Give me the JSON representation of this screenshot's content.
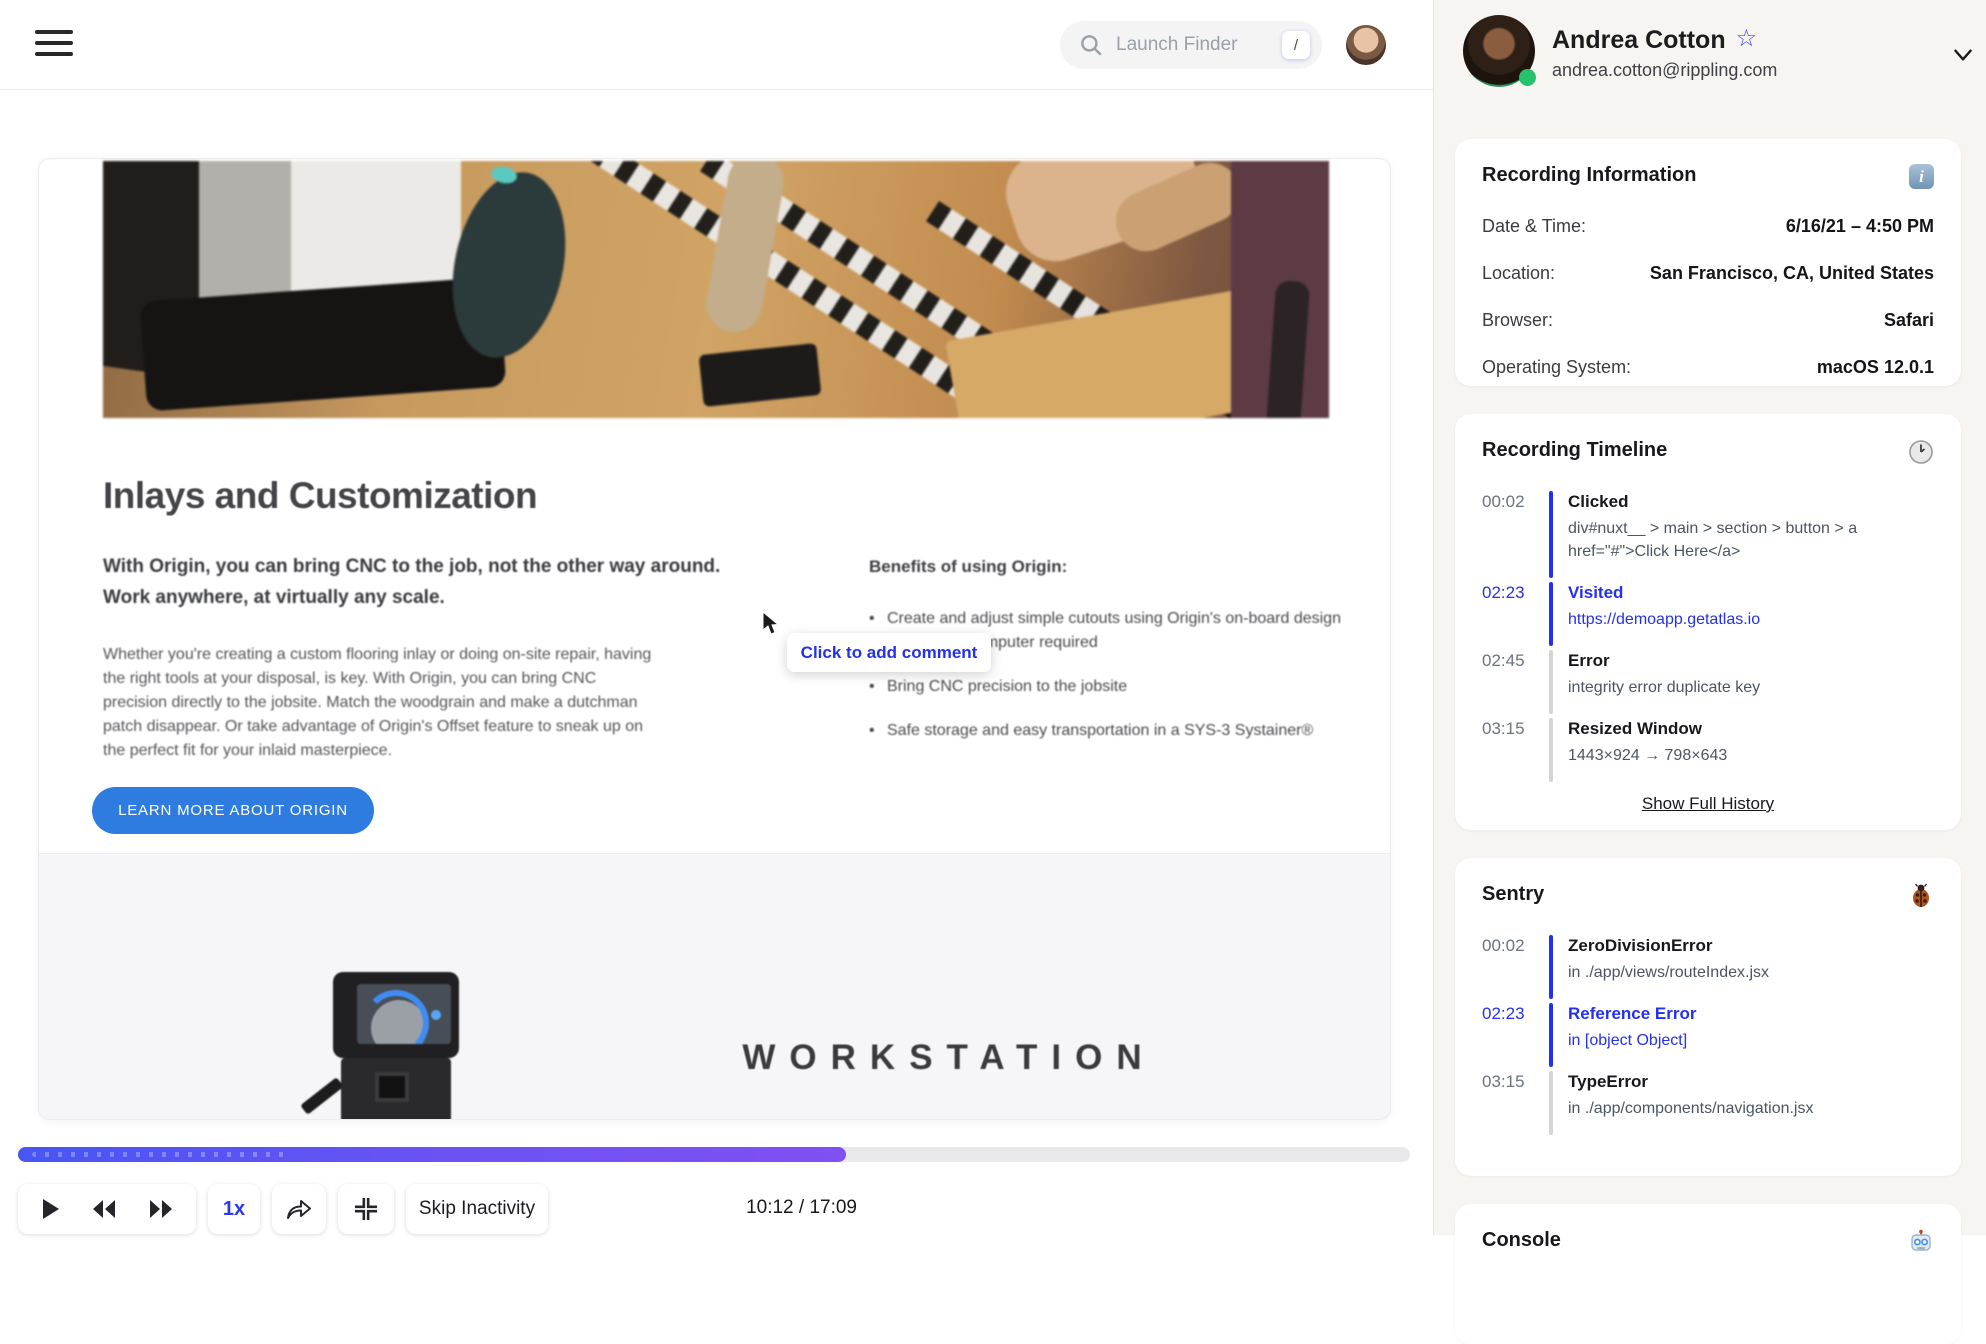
{
  "topbar": {
    "search_placeholder": "Launch Finder",
    "search_shortcut": "/"
  },
  "replay": {
    "url": "https://app.getatlas.io/auth/login?next=/customer-profile/3a092231-4d57-407d-8656-896dee8e4c24",
    "comment_tooltip": "Click to add comment",
    "page": {
      "heading": "Inlays and Customization",
      "intro_bold": "With Origin, you can bring CNC to the job, not the other way around. Work anywhere, at virtually any scale.",
      "paragraph": "Whether you're creating a custom flooring inlay or doing on-site repair, having the right tools at your disposal, is key. With Origin, you can bring CNC precision directly to the jobsite. Match the woodgrain and make a dutchman patch disappear. Or take advantage of Origin's Offset feature to sneak up on the perfect fit for your inlaid masterpiece.",
      "cta_label": "LEARN MORE ABOUT ORIGIN",
      "benefits_title": "Benefits of using Origin:",
      "benefits": [
        {
          "text": "Create and adjust simple cutouts using Origin's on-board design tools — no computer required"
        },
        {
          "text": "Bring CNC precision to the jobsite"
        },
        {
          "text": "Safe storage and easy transportation in a SYS-3 Systainer®"
        }
      ],
      "workstation_label": "WORKSTATION"
    }
  },
  "player": {
    "speed_label": "1x",
    "skip_inactivity_label": "Skip Inactivity",
    "time_display": "10:12 / 17:09",
    "progress_percent": 59.5,
    "progress_gradient": [
      "#4756f3",
      "#8050f2"
    ]
  },
  "sidebar": {
    "user": {
      "name": "Andrea Cotton",
      "email": "andrea.cotton@rippling.com",
      "star_icon": "☆"
    },
    "recording_information": {
      "title": "Recording Information",
      "icon": "info-icon",
      "rows": [
        {
          "label": "Date & Time:",
          "value": "6/16/21 – 4:50 PM"
        },
        {
          "label": "Location:",
          "value": "San Francisco, CA, United States"
        },
        {
          "label": "Browser:",
          "value": "Safari"
        },
        {
          "label": "Operating System:",
          "value": "macOS 12.0.1"
        }
      ]
    },
    "recording_timeline": {
      "title": "Recording Timeline",
      "icon": "clock-icon",
      "events": [
        {
          "time": "00:02",
          "title": "Clicked",
          "desc": "div#nuxt__ > main > section > button > a href=\"#\">Click Here</a>"
        },
        {
          "time": "02:23",
          "title": "Visited",
          "desc": "https://demoapp.getatlas.io"
        },
        {
          "time": "02:45",
          "title": "Error",
          "desc": "integrity error duplicate key"
        },
        {
          "time": "03:15",
          "title": "Resized Window",
          "desc": "1443×924 → 798×643"
        }
      ],
      "footer_link": "Show Full History"
    },
    "sentry": {
      "title": "Sentry",
      "icon": "bug-icon",
      "events": [
        {
          "time": "00:02",
          "title": "ZeroDivisionError",
          "desc": "in ./app/views/routeIndex.jsx"
        },
        {
          "time": "02:23",
          "title": "Reference Error",
          "desc": "in [object Object]"
        },
        {
          "time": "03:15",
          "title": "TypeError",
          "desc": "in ./app/components/navigation.jsx"
        }
      ]
    },
    "console": {
      "title": "Console",
      "icon": "robot-icon"
    }
  },
  "colors": {
    "accent_blue": "#2430f0",
    "cta_blue": "#2e7ce0",
    "sidebar_bg": "#f7f5f1",
    "progress_track": "#e9e9eb"
  }
}
